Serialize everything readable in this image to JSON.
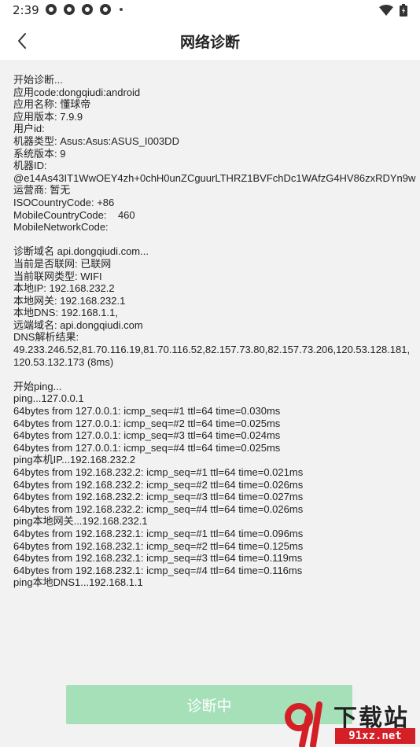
{
  "status_bar": {
    "time": "2:39"
  },
  "app_bar": {
    "title": "网络诊断"
  },
  "log_lines": [
    "开始诊断...",
    "应用code:dongqiudi:android",
    "应用名称: 懂球帝",
    "应用版本: 7.9.9",
    "用户id:",
    "机器类型: Asus:Asus:ASUS_I003DD",
    "系统版本: 9",
    "机器ID:",
    "@e14As43IT1WwOEY4zh+0chH0unZCguurLTHRZ1BVFchDc1WAfzG4HV86zxRDYn9w",
    "运营商: 暂无",
    "ISOCountryCode: +86",
    "MobileCountryCode:    460",
    "MobileNetworkCode:",
    "",
    "诊断域名 api.dongqiudi.com...",
    "当前是否联网: 已联网",
    "当前联网类型: WIFI",
    "本地IP: 192.168.232.2",
    "本地网关: 192.168.232.1",
    "本地DNS: 192.168.1.1,",
    "远端域名: api.dongqiudi.com",
    "DNS解析结果:",
    "49.233.246.52,81.70.116.19,81.70.116.52,82.157.73.80,82.157.73.206,120.53.128.181,",
    "120.53.132.173 (8ms)",
    "",
    "开始ping...",
    "ping...127.0.0.1",
    "64bytes from 127.0.0.1: icmp_seq=#1 ttl=64 time=0.030ms",
    "64bytes from 127.0.0.1: icmp_seq=#2 ttl=64 time=0.025ms",
    "64bytes from 127.0.0.1: icmp_seq=#3 ttl=64 time=0.024ms",
    "64bytes from 127.0.0.1: icmp_seq=#4 ttl=64 time=0.025ms",
    "ping本机IP...192.168.232.2",
    "64bytes from 192.168.232.2: icmp_seq=#1 ttl=64 time=0.021ms",
    "64bytes from 192.168.232.2: icmp_seq=#2 ttl=64 time=0.026ms",
    "64bytes from 192.168.232.2: icmp_seq=#3 ttl=64 time=0.027ms",
    "64bytes from 192.168.232.2: icmp_seq=#4 ttl=64 time=0.026ms",
    "ping本地网关...192.168.232.1",
    "64bytes from 192.168.232.1: icmp_seq=#1 ttl=64 time=0.096ms",
    "64bytes from 192.168.232.1: icmp_seq=#2 ttl=64 time=0.125ms",
    "64bytes from 192.168.232.1: icmp_seq=#3 ttl=64 time=0.119ms",
    "64bytes from 192.168.232.1: icmp_seq=#4 ttl=64 time=0.116ms",
    "ping本地DNS1...192.168.1.1"
  ],
  "bottom_button": {
    "label": "诊断中",
    "color": "#a5e0b8"
  },
  "watermark": {
    "brand_top": "下载站",
    "brand_bottom": "91xz.net"
  },
  "icons": {
    "status_left": [
      "app-notification-icon",
      "app-notification-icon",
      "app-notification-icon",
      "app-notification-icon"
    ],
    "status_right": [
      "wifi-icon",
      "battery-icon"
    ],
    "back": "back-arrow-icon"
  }
}
